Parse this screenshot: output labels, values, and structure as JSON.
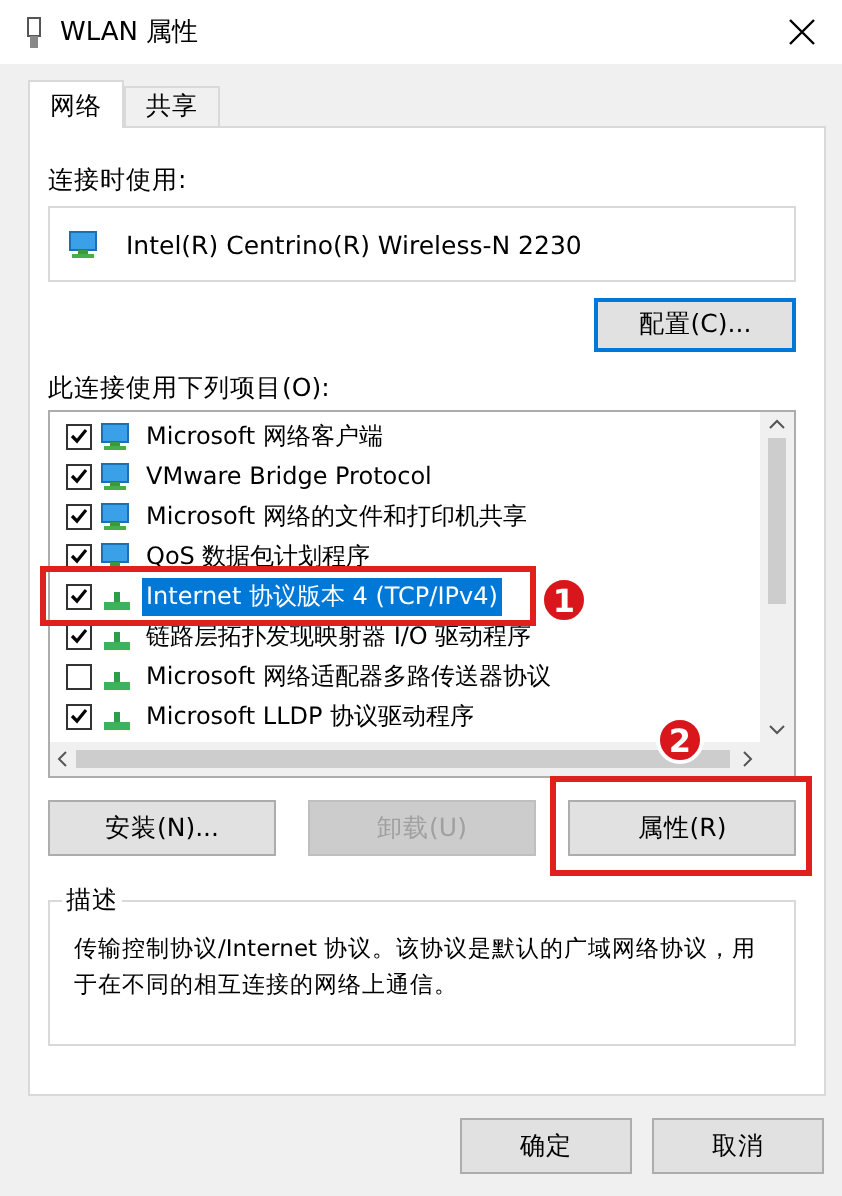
{
  "window": {
    "title": "WLAN 属性"
  },
  "tabs": [
    {
      "label": "网络",
      "selected": true
    },
    {
      "label": "共享",
      "selected": false
    }
  ],
  "connect_using": {
    "label": "连接时使用:",
    "adapter": "Intel(R) Centrino(R) Wireless-N 2230",
    "configure_button": "配置(C)..."
  },
  "items": {
    "label": "此连接使用下列项目(O):",
    "rows": [
      {
        "name": "Microsoft 网络客户端",
        "kind": "client",
        "checked": true,
        "selected": false
      },
      {
        "name": "VMware Bridge Protocol",
        "kind": "client",
        "checked": true,
        "selected": false
      },
      {
        "name": "Microsoft 网络的文件和打印机共享",
        "kind": "client",
        "checked": true,
        "selected": false
      },
      {
        "name": "QoS 数据包计划程序",
        "kind": "client",
        "checked": true,
        "selected": false
      },
      {
        "name": "Internet 协议版本 4 (TCP/IPv4)",
        "kind": "protocol",
        "checked": true,
        "selected": true
      },
      {
        "name": "链路层拓扑发现映射器 I/O 驱动程序",
        "kind": "protocol",
        "checked": true,
        "selected": false
      },
      {
        "name": "Microsoft 网络适配器多路传送器协议",
        "kind": "protocol",
        "checked": false,
        "selected": false
      },
      {
        "name": "Microsoft LLDP 协议驱动程序",
        "kind": "protocol",
        "checked": true,
        "selected": false
      }
    ]
  },
  "buttons": [
    {
      "label": "安装(N)...",
      "disabled": false
    },
    {
      "label": "卸载(U)",
      "disabled": true
    },
    {
      "label": "属性(R)",
      "disabled": false
    }
  ],
  "description": {
    "title": "描述",
    "text": "传输控制协议/Internet 协议。该协议是默认的广域网络协议，用于在不同的相互连接的网络上通信。"
  },
  "dialog_buttons": [
    "确定",
    "取消"
  ],
  "annotations": [
    {
      "label": "1"
    },
    {
      "label": "2"
    }
  ]
}
